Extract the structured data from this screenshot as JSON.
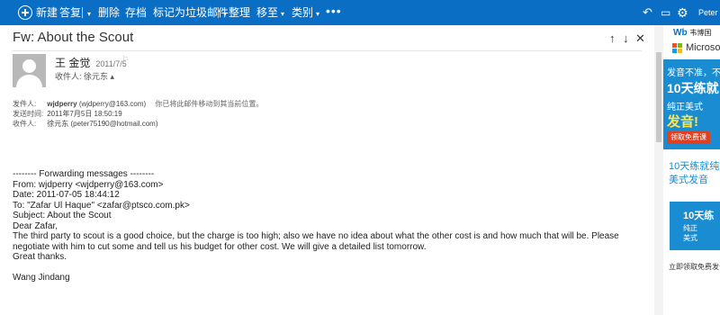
{
  "toolbar": {
    "new_label": "新建",
    "reply_label": "答复",
    "delete_label": "删除",
    "archive_label": "存档",
    "junk_label": "标记为垃圾邮件",
    "sweep_label": "整理",
    "move_label": "移至",
    "category_label": "类别",
    "more_label": "•••",
    "user_name": "Peter X",
    "undo_icon": "↶",
    "chat_icon": "▭",
    "settings_icon": "⚙"
  },
  "message": {
    "subject": "Fw: About the Scout",
    "nav_up": "↑",
    "nav_down": "↓",
    "close": "✕",
    "sender_name": "王 金觉",
    "sent_date": "2011/7/5",
    "flag": "⚐",
    "recipients_line": "收件人: 徐元东 ▴",
    "header": {
      "from_label": "发件人:",
      "from_name": "wjdperry",
      "from_email": "(wjdperry@163.com)",
      "from_note": "你已将此邮件移动到其当前位置。",
      "sent_label": "发送时间:",
      "sent_value": "2011年7月5日 18:50:19",
      "to_label": "收件人:",
      "to_value": "徐元东 (peter75190@hotmail.com)"
    },
    "body_lines": [
      "-------- Forwarding messages --------",
      "From: wjdperry <wjdperry@163.com>",
      "Date: 2011-07-05 18:44:12",
      "To: \"Zafar Ul Haque\" <zafar@ptsco.com.pk>",
      "Subject: About the Scout",
      "Dear Zafar,",
      "The third party to scout is a good choice, but the charge is too high; also we have no idea about what the  other cost is and how much that will be. Please",
      "negotiate with him to cut some and tell us his budget for other cost. We will give a detailed list tomorrow.",
      "Great thanks.",
      "",
      "Wang Jindang"
    ]
  },
  "ad": {
    "logo_main": "Wb",
    "logo_sub": "韦博国",
    "logo_tag": "Web International",
    "ms_text": "Microsof",
    "banner_line1": "发音不准，不",
    "banner_line2": "10天练就",
    "banner_line3": "纯正美式",
    "banner_line4": "发音!",
    "banner_button": "领取免费课",
    "tagline_1": "10天练就纯",
    "tagline_2": "美式发音",
    "box_line1": "10天练",
    "box_line2": "纯正",
    "box_line3": "美式",
    "footer": "立即领取免费发音"
  },
  "colors": {
    "toolbar_bg": "#0a6fc4",
    "ad_blue": "#1a8dd2"
  }
}
